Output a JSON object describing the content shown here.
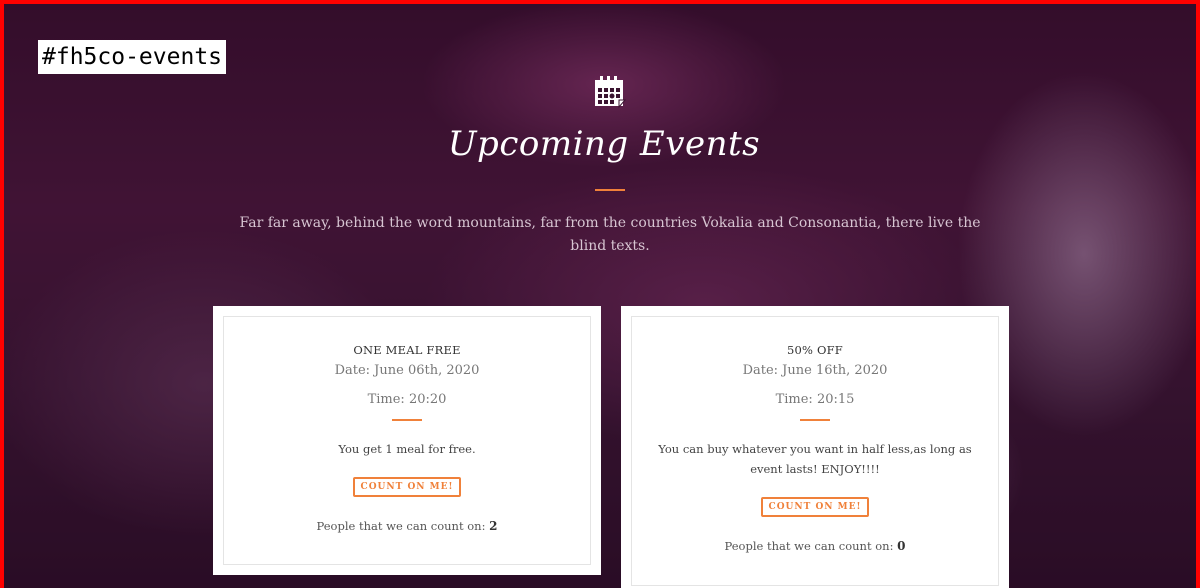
{
  "anchor": {
    "label": "#fh5co-events"
  },
  "section": {
    "icon": "calendar-icon",
    "title": "Upcoming Events",
    "subtitle": "Far far away, behind the word mountains, far from the countries Vokalia and Consonantia, there live the blind texts."
  },
  "accent_color": "#f0813a",
  "events": [
    {
      "name": "ONE MEAL FREE",
      "date": "Date: June 06th, 2020",
      "time": "Time: 20:20",
      "description": "You get 1 meal for free.",
      "button_label": "COUNT ON ME!",
      "count_label": "People that we can count on:",
      "count_value": "2"
    },
    {
      "name": "50% OFF",
      "date": "Date: June 16th, 2020",
      "time": "Time: 20:15",
      "description": "You can buy whatever you want in half less,as long as event lasts! ENJOY!!!!",
      "button_label": "COUNT ON ME!",
      "count_label": "People that we can count on:",
      "count_value": "0"
    }
  ]
}
